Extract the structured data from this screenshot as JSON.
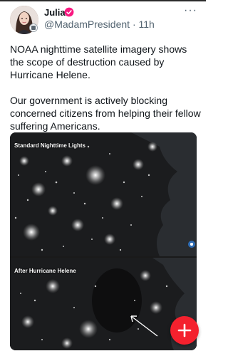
{
  "post": {
    "author_name": "Julia",
    "handle": "@MadamPresident",
    "separator": "·",
    "time": "11h",
    "more_icon": "more-horizontal-icon",
    "paragraphs": [
      "NOAA nighttime satellite imagery shows the scope of destruction caused by Hurricane Helene.",
      "Our government is actively blocking concerned citizens from helping their fellow suffering Americans."
    ]
  },
  "media": {
    "panels": [
      {
        "label": "Standard Nighttime Lights"
      },
      {
        "label": "After Hurricane Helene"
      }
    ]
  },
  "fab": {
    "icon": "plus-icon"
  },
  "colors": {
    "verified": "#f91880",
    "fab": "#f4212e",
    "secondary_text": "#536471"
  }
}
